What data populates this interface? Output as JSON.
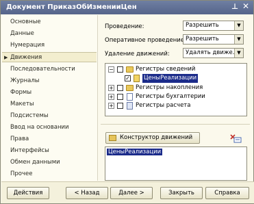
{
  "window": {
    "title": "Документ ПриказОбИзменииЦен",
    "pin_icon": "pin-icon",
    "close_icon": "close-icon"
  },
  "nav": {
    "items": [
      {
        "label": "Основные",
        "active": false
      },
      {
        "label": "Данные",
        "active": false
      },
      {
        "label": "Нумерация",
        "active": false
      },
      {
        "label": "Движения",
        "active": true
      },
      {
        "label": "Последовательности",
        "active": false
      },
      {
        "label": "Журналы",
        "active": false
      },
      {
        "label": "Формы",
        "active": false
      },
      {
        "label": "Макеты",
        "active": false
      },
      {
        "label": "Подсистемы",
        "active": false
      },
      {
        "label": "Ввод на основании",
        "active": false
      },
      {
        "label": "Права",
        "active": false
      },
      {
        "label": "Интерфейсы",
        "active": false
      },
      {
        "label": "Обмен данными",
        "active": false
      },
      {
        "label": "Прочее",
        "active": false
      }
    ]
  },
  "form": {
    "posting_label": "Проведение:",
    "posting_value": "Разрешить",
    "online_posting_label": "Оперативное проведение:",
    "online_posting_value": "Разрешить",
    "delete_movements_label": "Удаление движений:",
    "delete_movements_value": "Удалять движе..."
  },
  "tree": {
    "nodes": [
      {
        "label": "Регистры сведений",
        "expander": "−",
        "checked": false
      },
      {
        "label": "ЦеныРеализации",
        "expander": "",
        "checked": true,
        "selected": true
      },
      {
        "label": "Регистры накопления",
        "expander": "+",
        "checked": false
      },
      {
        "label": "Регистры бухгалтерии",
        "expander": "+",
        "checked": false
      },
      {
        "label": "Регистры расчета",
        "expander": "+",
        "checked": false
      }
    ]
  },
  "constructor_button": {
    "label": "Конструктор движений"
  },
  "memo": {
    "text": "ЦеныРеализации"
  },
  "buttons": {
    "actions": "Действия",
    "back": "< Назад",
    "next": "Далее >",
    "close": "Закрыть",
    "help": "Справка"
  }
}
